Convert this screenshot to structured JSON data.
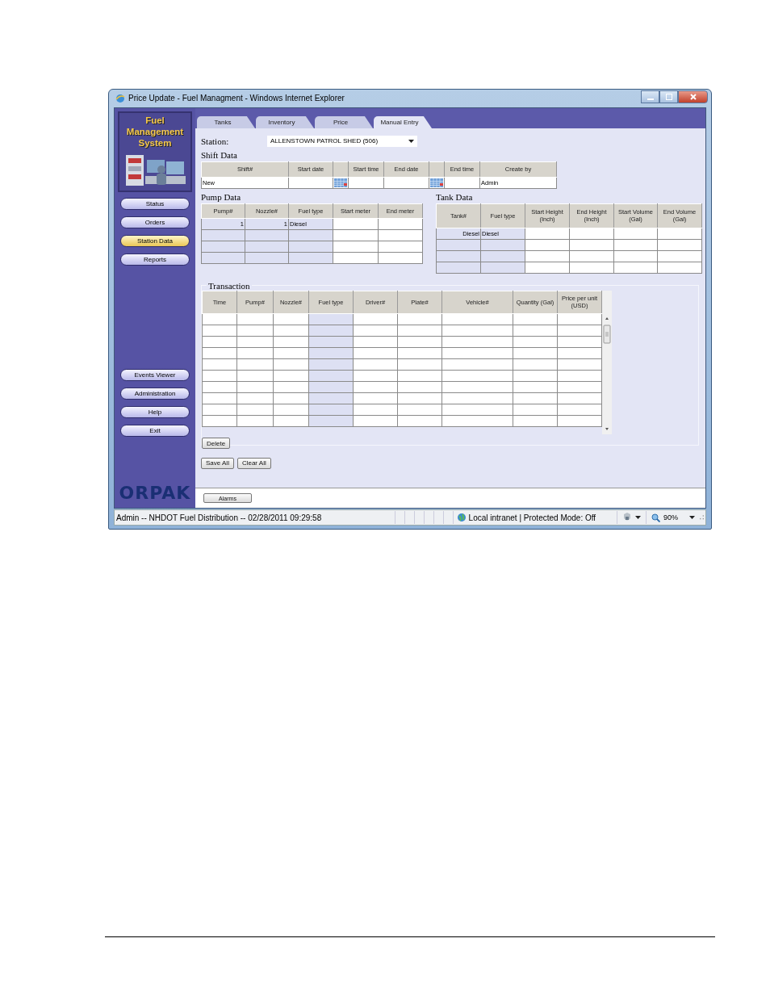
{
  "window": {
    "title": "Price Update - Fuel Managment - Windows Internet Explorer"
  },
  "sidebar": {
    "logo_lines": [
      "Fuel",
      "Management",
      "System"
    ],
    "nav_top": [
      {
        "label": "Status",
        "selected": false
      },
      {
        "label": "Orders",
        "selected": false
      },
      {
        "label": "Station Data",
        "selected": true
      },
      {
        "label": "Reports",
        "selected": false
      }
    ],
    "nav_bottom": [
      {
        "label": "Events Viewer",
        "selected": false
      },
      {
        "label": "Administration",
        "selected": false
      },
      {
        "label": "Help",
        "selected": false
      },
      {
        "label": "Exit",
        "selected": false
      }
    ],
    "brand": "ORPAK"
  },
  "tabs": [
    {
      "label": "Tanks",
      "selected": false
    },
    {
      "label": "Inventory",
      "selected": false
    },
    {
      "label": "Price",
      "selected": false
    },
    {
      "label": "Manual Entry",
      "selected": true
    }
  ],
  "station": {
    "label": "Station:",
    "value": "ALLENSTOWN PATROL SHED (506)"
  },
  "shift_data": {
    "title": "Shift Data",
    "columns": [
      {
        "kind": "text",
        "label": "Shift#"
      },
      {
        "kind": "text",
        "label": "Start date"
      },
      {
        "kind": "calendar"
      },
      {
        "kind": "text",
        "label": "Start time"
      },
      {
        "kind": "text",
        "label": "End date"
      },
      {
        "kind": "calendar"
      },
      {
        "kind": "text",
        "label": "End time"
      },
      {
        "kind": "text",
        "label": "Create by"
      }
    ],
    "rows": [
      [
        "New",
        null,
        null,
        null,
        null,
        null,
        null,
        "Admin"
      ]
    ]
  },
  "pump_data": {
    "title": "Pump Data",
    "columns": [
      {
        "kind": "text",
        "label": "Pump#",
        "shaded": true
      },
      {
        "kind": "text",
        "label": "Nozzle#",
        "shaded": true
      },
      {
        "kind": "text",
        "label": "Fuel type",
        "shaded": true
      },
      {
        "kind": "text",
        "label": "Start meter",
        "shaded": false
      },
      {
        "kind": "text",
        "label": "End meter",
        "shaded": false
      }
    ],
    "rows": [
      [
        "1",
        "1",
        "Diesel",
        null,
        null
      ],
      [
        null,
        null,
        null,
        null,
        null
      ],
      [
        null,
        null,
        null,
        null,
        null
      ],
      [
        null,
        null,
        null,
        null,
        null
      ]
    ]
  },
  "tank_data": {
    "title": "Tank Data",
    "columns": [
      {
        "kind": "text",
        "label": "Tank#",
        "shaded": true
      },
      {
        "kind": "text",
        "label": "Fuel type",
        "shaded": true
      },
      {
        "kind": "text",
        "label": "Start Height (Inch)",
        "shaded": false
      },
      {
        "kind": "text",
        "label": "End Height (Inch)",
        "shaded": false
      },
      {
        "kind": "text",
        "label": "Start Volume (Gal)",
        "shaded": false
      },
      {
        "kind": "text",
        "label": "End Volume (Gal)",
        "shaded": false
      }
    ],
    "rows": [
      [
        "Diesel",
        "Diesel",
        null,
        null,
        null,
        null
      ],
      [
        null,
        null,
        null,
        null,
        null,
        null
      ],
      [
        null,
        null,
        null,
        null,
        null,
        null
      ],
      [
        null,
        null,
        null,
        null,
        null,
        null
      ]
    ]
  },
  "transaction": {
    "title": "Transaction",
    "columns": [
      {
        "kind": "text",
        "label": "Time",
        "shaded": false
      },
      {
        "kind": "text",
        "label": "Pump#",
        "shaded": false
      },
      {
        "kind": "text",
        "label": "Nozzle#",
        "shaded": false
      },
      {
        "kind": "text",
        "label": "Fuel type",
        "shaded": true
      },
      {
        "kind": "text",
        "label": "Driver#",
        "shaded": false
      },
      {
        "kind": "text",
        "label": "Plate#",
        "shaded": false
      },
      {
        "kind": "text",
        "label": "Vehicle#",
        "shaded": false
      },
      {
        "kind": "text",
        "label": "Quantity (Gal)",
        "shaded": false
      },
      {
        "kind": "text",
        "label": "Price per unit (USD)",
        "shaded": false
      }
    ],
    "rows": [
      [
        null,
        null,
        null,
        null,
        null,
        null,
        null,
        null,
        null
      ],
      [
        null,
        null,
        null,
        null,
        null,
        null,
        null,
        null,
        null
      ],
      [
        null,
        null,
        null,
        null,
        null,
        null,
        null,
        null,
        null
      ],
      [
        null,
        null,
        null,
        null,
        null,
        null,
        null,
        null,
        null
      ],
      [
        null,
        null,
        null,
        null,
        null,
        null,
        null,
        null,
        null
      ],
      [
        null,
        null,
        null,
        null,
        null,
        null,
        null,
        null,
        null
      ],
      [
        null,
        null,
        null,
        null,
        null,
        null,
        null,
        null,
        null
      ],
      [
        null,
        null,
        null,
        null,
        null,
        null,
        null,
        null,
        null
      ],
      [
        null,
        null,
        null,
        null,
        null,
        null,
        null,
        null,
        null
      ],
      [
        null,
        null,
        null,
        null,
        null,
        null,
        null,
        null,
        null
      ]
    ],
    "delete_button": "Delete"
  },
  "actions": [
    "Save All",
    "Clear All"
  ],
  "alarms_button": "Alarms",
  "status_bar": {
    "text": "Admin -- NHDOT Fuel Distribution -- 02/28/2011  09:29:58",
    "zone": "Local intranet | Protected Mode: Off",
    "zoom": "90%"
  }
}
